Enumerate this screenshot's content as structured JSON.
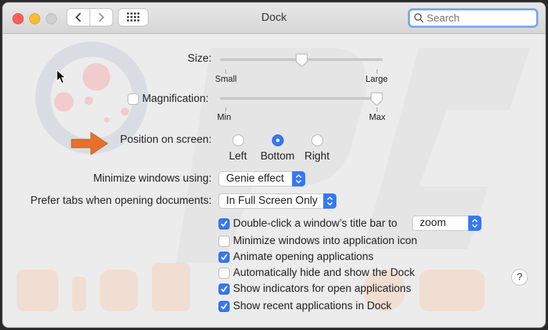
{
  "window": {
    "title": "Dock",
    "search_placeholder": "Search"
  },
  "settings": {
    "size": {
      "label": "Size:",
      "min_label": "Small",
      "max_label": "Large",
      "level": 0.5
    },
    "magnification": {
      "label": "Magnification:",
      "min_label": "Min",
      "max_label": "Max",
      "checked": false,
      "level": 1.0
    },
    "position": {
      "label": "Position on screen:",
      "options": [
        "Left",
        "Bottom",
        "Right"
      ],
      "selected": "Bottom"
    },
    "minimize": {
      "label": "Minimize windows using:",
      "value": "Genie effect"
    },
    "prefer_tabs": {
      "label": "Prefer tabs when opening documents:",
      "value": "In Full Screen Only"
    },
    "double_click": {
      "label": "Double-click a window’s title bar to",
      "value": "zoom",
      "checked": true
    },
    "checkboxes": [
      {
        "label": "Minimize windows into application icon",
        "checked": false
      },
      {
        "label": "Animate opening applications",
        "checked": true
      },
      {
        "label": "Automatically hide and show the Dock",
        "checked": false
      },
      {
        "label": "Show indicators for open applications",
        "checked": true
      },
      {
        "label": "Show recent applications in Dock",
        "checked": true
      }
    ],
    "help_label": "?"
  },
  "colors": {
    "accent": "#3478f6",
    "arrow": "#e8712a",
    "close": "#fc5f57",
    "minimize": "#fdbc2e"
  }
}
